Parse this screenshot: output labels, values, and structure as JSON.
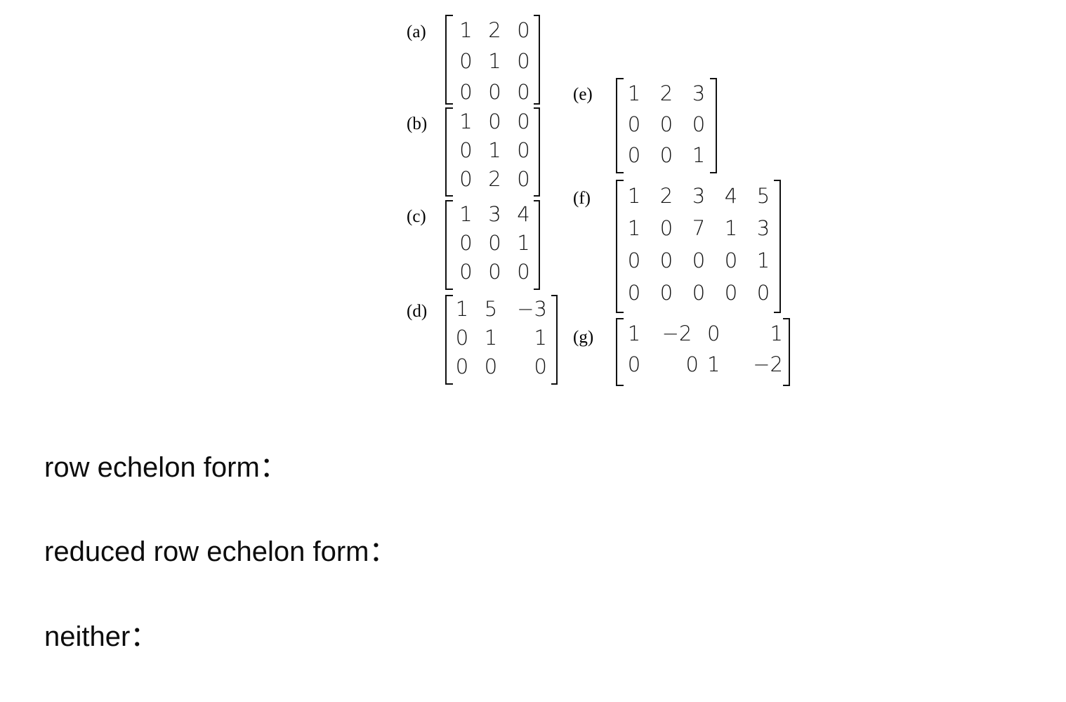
{
  "matrices": [
    {
      "id": "a",
      "label": "(a)",
      "rows": [
        [
          "1",
          "2",
          "0"
        ],
        [
          "0",
          "1",
          "0"
        ],
        [
          "0",
          "0",
          "0"
        ]
      ]
    },
    {
      "id": "b",
      "label": "(b)",
      "rows": [
        [
          "1",
          "0",
          "0"
        ],
        [
          "0",
          "1",
          "0"
        ],
        [
          "0",
          "2",
          "0"
        ]
      ]
    },
    {
      "id": "c",
      "label": "(c)",
      "rows": [
        [
          "1",
          "3",
          "4"
        ],
        [
          "0",
          "0",
          "1"
        ],
        [
          "0",
          "0",
          "0"
        ]
      ]
    },
    {
      "id": "d",
      "label": "(d)",
      "rows": [
        [
          "1",
          "5",
          "−3"
        ],
        [
          "0",
          "1",
          "1"
        ],
        [
          "0",
          "0",
          "0"
        ]
      ]
    },
    {
      "id": "e",
      "label": "(e)",
      "rows": [
        [
          "1",
          "2",
          "3"
        ],
        [
          "0",
          "0",
          "0"
        ],
        [
          "0",
          "0",
          "1"
        ]
      ]
    },
    {
      "id": "f",
      "label": "(f)",
      "rows": [
        [
          "1",
          "2",
          "3",
          "4",
          "5"
        ],
        [
          "1",
          "0",
          "7",
          "1",
          "3"
        ],
        [
          "0",
          "0",
          "0",
          "0",
          "1"
        ],
        [
          "0",
          "0",
          "0",
          "0",
          "0"
        ]
      ]
    },
    {
      "id": "g",
      "label": "(g)",
      "rows": [
        [
          "1",
          "−2",
          "0",
          "1"
        ],
        [
          "0",
          "0",
          "1",
          "−2"
        ]
      ]
    }
  ],
  "prompts": {
    "row_echelon": "row echelon form：",
    "reduced_row_echelon": "reduced row echelon form：",
    "neither": "neither："
  }
}
